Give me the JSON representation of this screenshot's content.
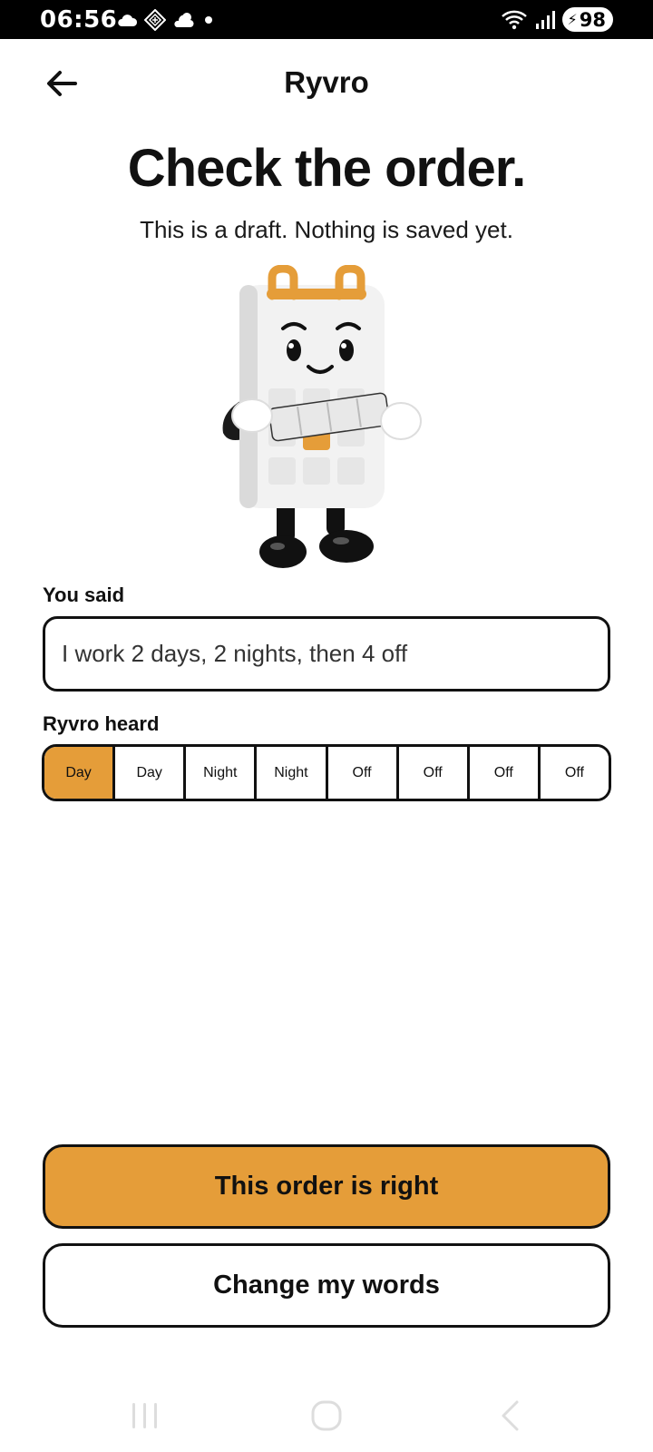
{
  "status_bar": {
    "time": "06:56",
    "battery": "98",
    "icons_left": [
      "cloud-icon",
      "vpn-diamond-icon",
      "weather-cloud-icon",
      "dot-icon"
    ],
    "icons_right": [
      "wifi-icon",
      "signal-icon",
      "battery-icon"
    ]
  },
  "header": {
    "title": "Ryvro",
    "back_icon": "arrow-left-icon"
  },
  "main": {
    "heading": "Check the order.",
    "subheading": "This is a draft. Nothing is saved yet.",
    "you_said_label": "You said",
    "you_said_value": "I work 2 days, 2 nights, then 4 off",
    "heard_label": "Ryvro heard",
    "sequence": [
      "Day",
      "Day",
      "Night",
      "Night",
      "Off",
      "Off",
      "Off",
      "Off"
    ],
    "active_index": 0
  },
  "actions": {
    "confirm_label": "This order is right",
    "change_label": "Change my words"
  },
  "colors": {
    "accent": "#e59d39",
    "border": "#111111",
    "status_bar": "#000000"
  },
  "nav": [
    "recent-apps-icon",
    "home-icon",
    "back-nav-icon"
  ]
}
